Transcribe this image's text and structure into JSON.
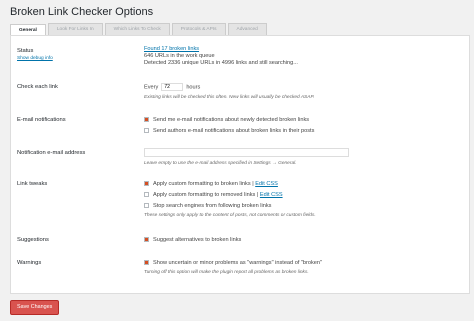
{
  "page": {
    "title": "Broken Link Checker Options"
  },
  "tabs": [
    "General",
    "Look For Links In",
    "Which Links To Check",
    "Protocols & APIs",
    "Advanced"
  ],
  "status": {
    "label": "Status",
    "debug_link": "Show debug info",
    "broken_links": "Found 17 broken links",
    "work_queue": "646 URLs in the work queue",
    "detected": "Detected 2336 unique URLs in 4996 links and still searching..."
  },
  "check_each": {
    "label": "Check each link",
    "prefix": "Every",
    "value": "72",
    "suffix": "hours",
    "note": "Existing links will be checked this often. New links will usually be checked ASAP."
  },
  "email": {
    "label": "E-mail notifications",
    "opt1": "Send me e-mail notifications about newly detected broken links",
    "opt1_checked": true,
    "opt2": "Send authors e-mail notifications about broken links in their posts",
    "opt2_checked": false
  },
  "notif_address": {
    "label": "Notification e-mail address",
    "value": "",
    "note": "Leave empty to use the e-mail address specified in Settings → General."
  },
  "link_tweaks": {
    "label": "Link tweaks",
    "opt1": "Apply custom formatting to broken links",
    "opt1_checked": true,
    "opt2": "Apply custom formatting to removed links",
    "opt2_checked": false,
    "opt3": "Stop search engines from following broken links",
    "opt3_checked": false,
    "sep": "|",
    "edit_css": "Edit CSS",
    "note": "These settings only apply to the content of posts, not comments or custom fields."
  },
  "suggestions": {
    "label": "Suggestions",
    "opt": "Suggest alternatives to broken links",
    "checked": true
  },
  "warnings": {
    "label": "Warnings",
    "opt": "Show uncertain or minor problems as \"warnings\" instead of \"broken\"",
    "checked": true,
    "note": "Turning off this option will make the plugin report all problems as broken links."
  },
  "save": {
    "label": "Save Changes"
  },
  "colors": {
    "accent": "#d54e21",
    "link": "#0073aa",
    "save": "#d9534f"
  }
}
